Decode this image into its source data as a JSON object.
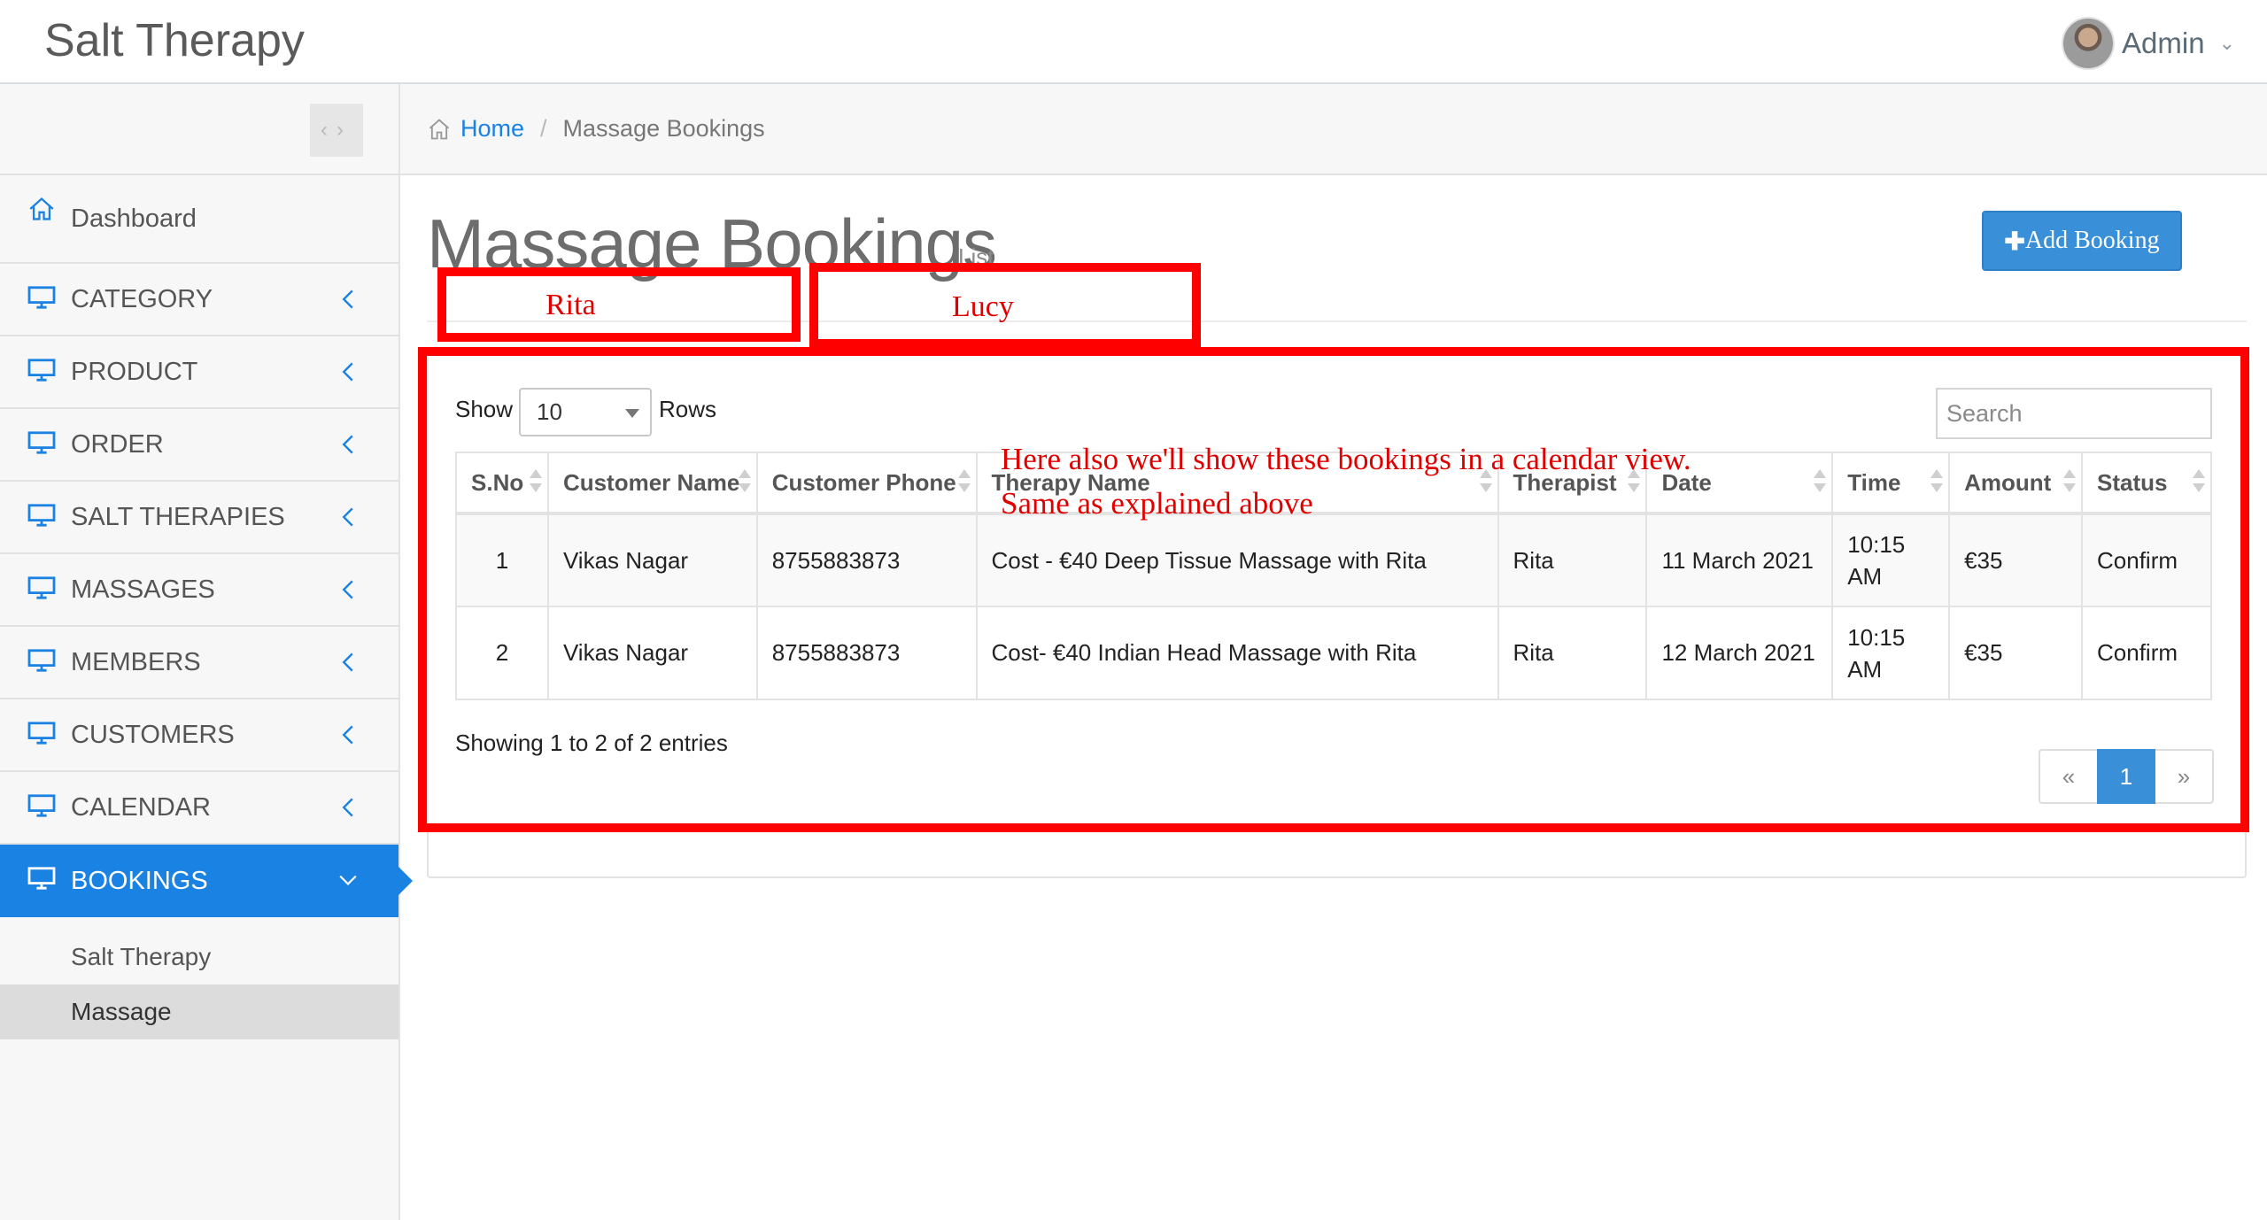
{
  "app": {
    "title": "Salt Therapy"
  },
  "user": {
    "name": "Admin"
  },
  "breadcrumb": {
    "home": "Home",
    "current": "Massage Bookings"
  },
  "sidebar": {
    "items": [
      {
        "label": "Dashboard",
        "icon": "home-icon"
      },
      {
        "label": "CATEGORY",
        "icon": "monitor-icon"
      },
      {
        "label": "PRODUCT",
        "icon": "monitor-icon"
      },
      {
        "label": "ORDER",
        "icon": "monitor-icon"
      },
      {
        "label": "SALT THERAPIES",
        "icon": "monitor-icon"
      },
      {
        "label": "MASSAGES",
        "icon": "monitor-icon"
      },
      {
        "label": "MEMBERS",
        "icon": "monitor-icon"
      },
      {
        "label": "CUSTOMERS",
        "icon": "monitor-icon"
      },
      {
        "label": "CALENDAR",
        "icon": "monitor-icon"
      },
      {
        "label": "BOOKINGS",
        "icon": "monitor-icon",
        "active": true
      }
    ],
    "subitems": [
      {
        "label": "Salt Therapy"
      },
      {
        "label": "Massage",
        "active": true
      }
    ]
  },
  "page": {
    "title": "Massage Bookings",
    "subtitle": "List",
    "add_button": "Add Booking"
  },
  "table_controls": {
    "show_label": "Show",
    "length_value": "10",
    "rows_label": "Rows",
    "search_placeholder": "Search"
  },
  "table": {
    "columns": [
      "S.No",
      "Customer Name",
      "Customer Phone",
      "Therapy Name",
      "Therapist",
      "Date",
      "Time",
      "Amount",
      "Status"
    ],
    "rows": [
      {
        "sno": "1",
        "customer_name": "Vikas Nagar",
        "customer_phone": "8755883873",
        "therapy_name": "Cost - €40 Deep Tissue Massage with Rita",
        "therapist": "Rita",
        "date": "11 March 2021",
        "time_line1": "10:15",
        "time_line2": "AM",
        "amount": "€35",
        "status": "Confirm"
      },
      {
        "sno": "2",
        "customer_name": "Vikas Nagar",
        "customer_phone": "8755883873",
        "therapy_name": "Cost- €40 Indian Head Massage with Rita",
        "therapist": "Rita",
        "date": "12 March 2021",
        "time_line1": "10:15",
        "time_line2": "AM",
        "amount": "€35",
        "status": "Confirm"
      }
    ]
  },
  "table_info": "Showing 1 to 2 of 2 entries",
  "pagination": {
    "prev": "«",
    "current": "1",
    "next": "»"
  },
  "annotations": {
    "tab1": "Rita",
    "tab2": "Lucy",
    "note_line1": "Here also we'll show these bookings in a calendar view.",
    "note_line2": "Same as explained above",
    "color": "#ff0000"
  },
  "colors": {
    "accent": "#1a82e2",
    "button": "#3a8fd9"
  }
}
